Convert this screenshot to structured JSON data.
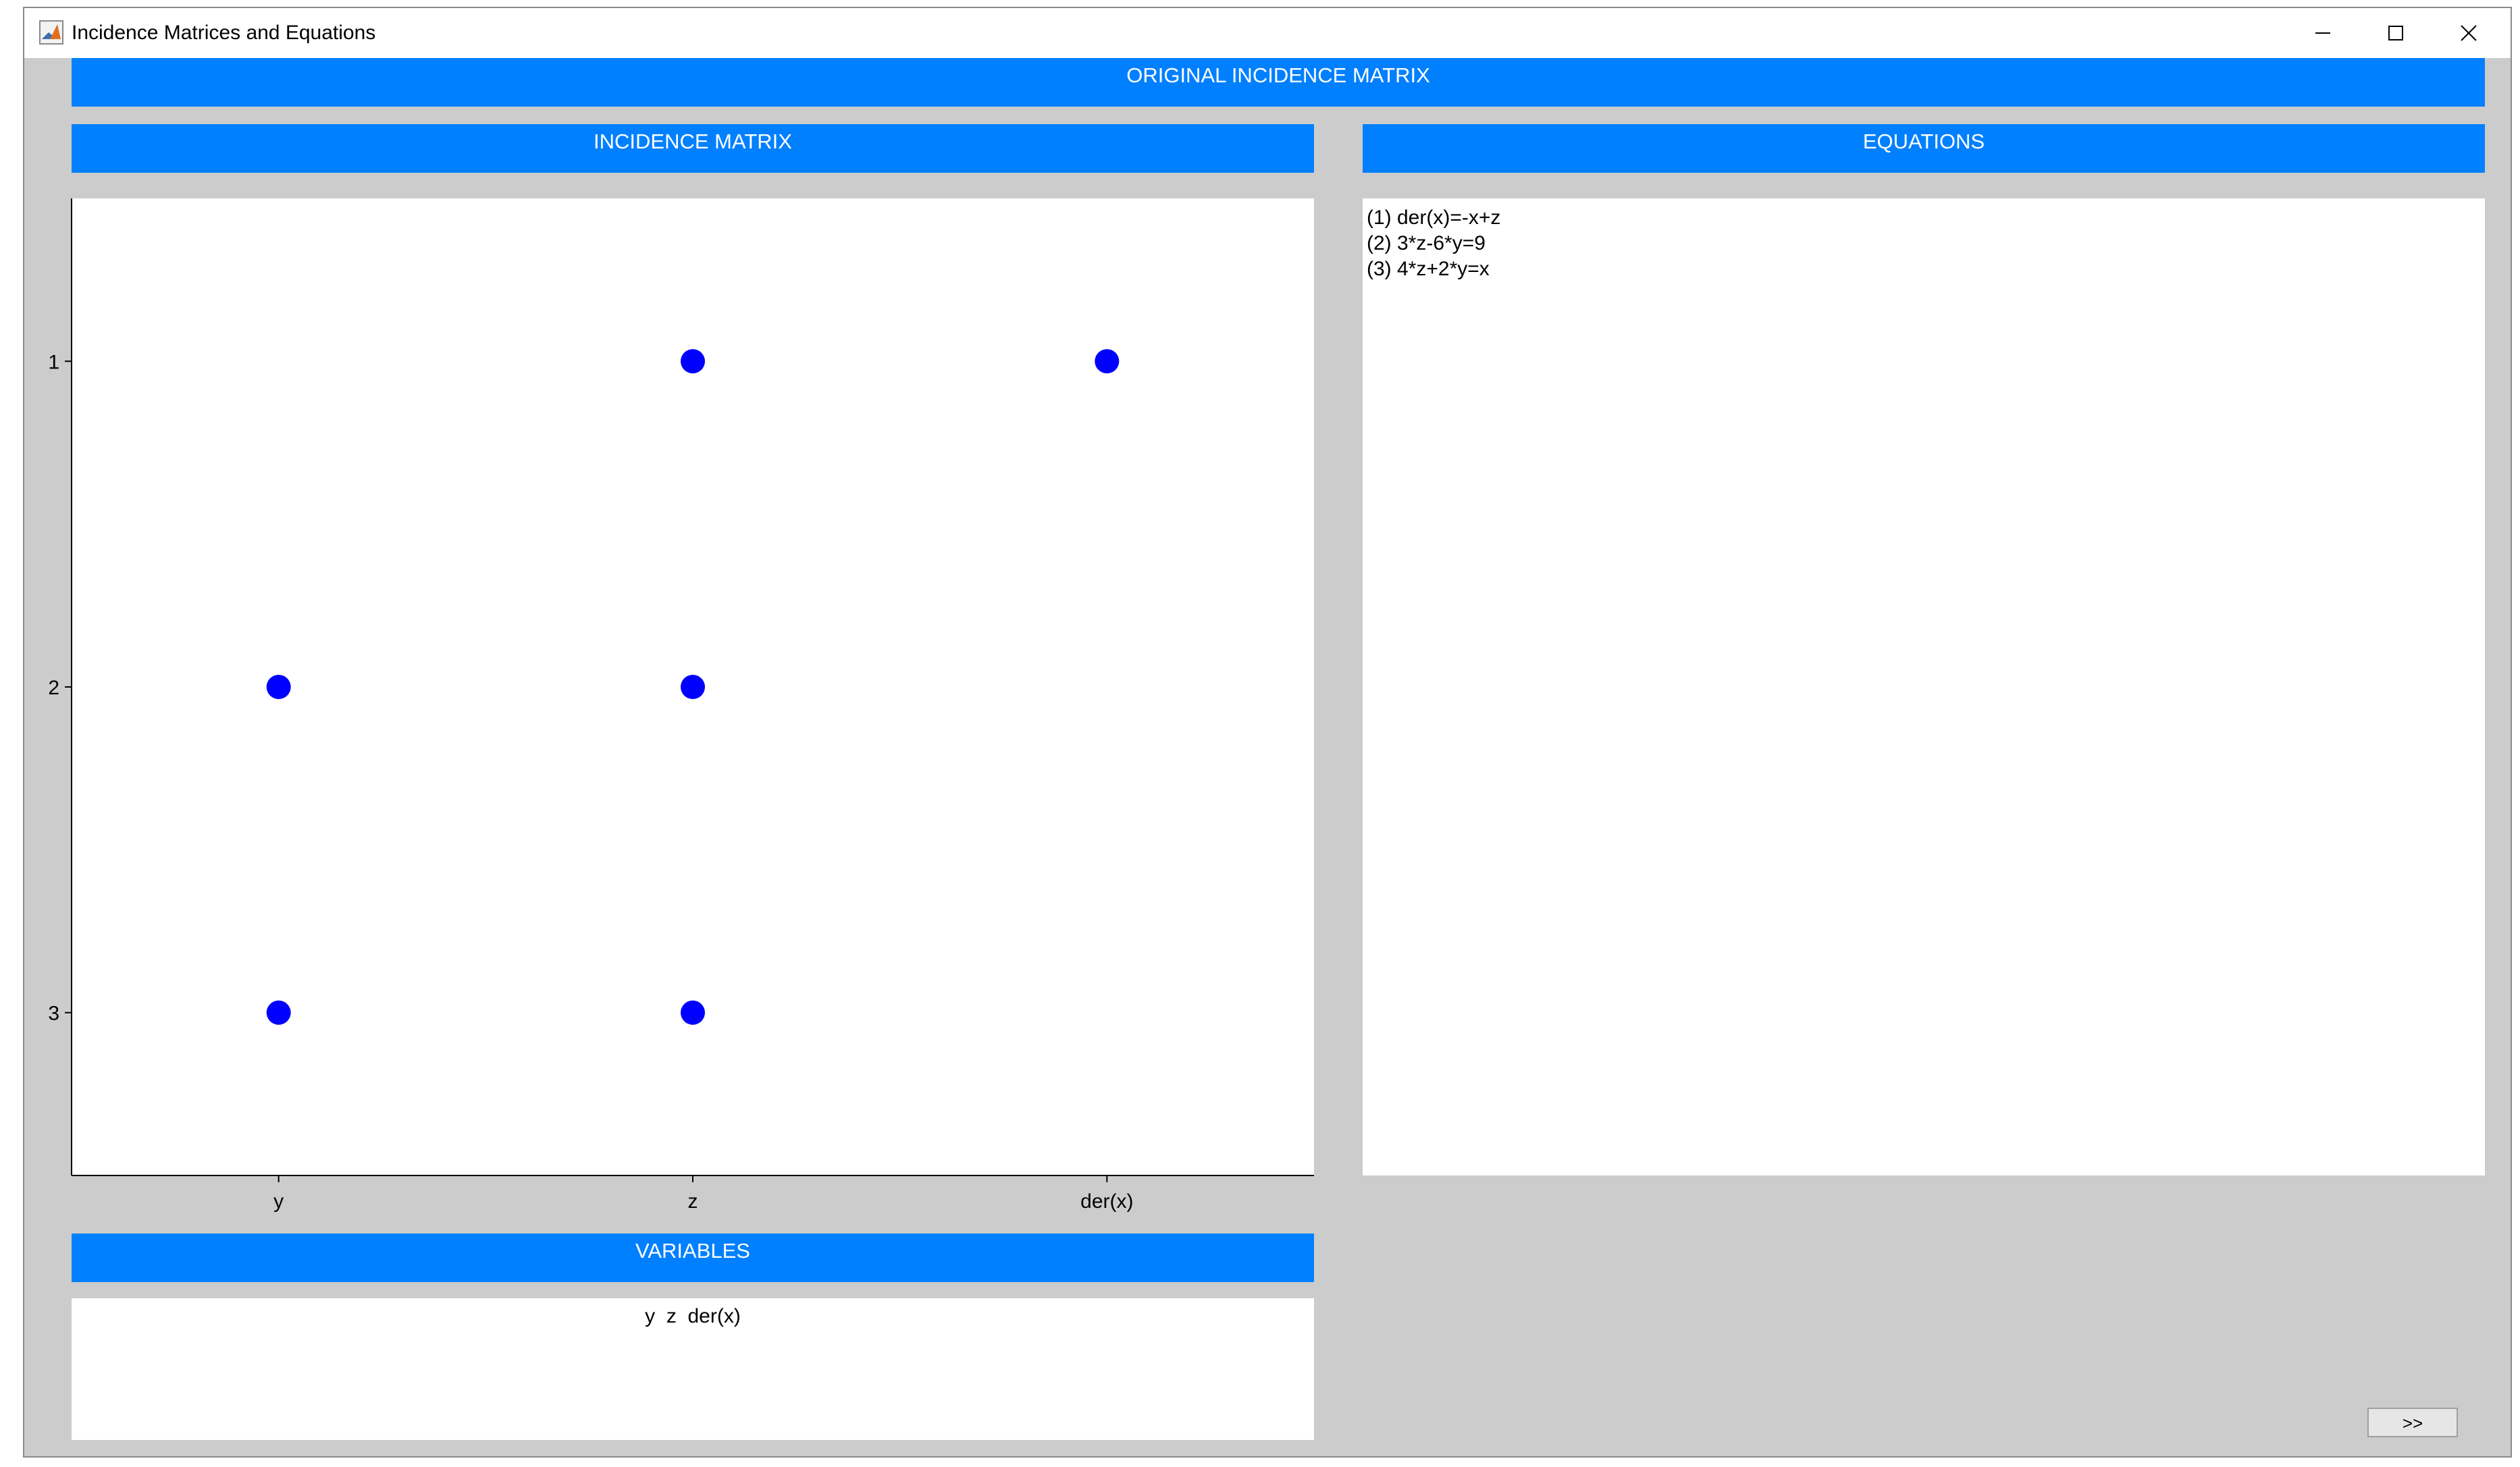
{
  "window": {
    "title": "Incidence Matrices and Equations",
    "icon": "matlab-icon"
  },
  "header": {
    "title": "ORIGINAL INCIDENCE MATRIX"
  },
  "incidence": {
    "title": "INCIDENCE MATRIX",
    "chart_data": {
      "type": "scatter",
      "x_categories": [
        "y",
        "z",
        "der(x)"
      ],
      "y_ticks": [
        "1",
        "2",
        "3"
      ],
      "y_axis_reversed": true,
      "marker_color": "#0000ff",
      "points": [
        {
          "x": "z",
          "y": 1
        },
        {
          "x": "der(x)",
          "y": 1
        },
        {
          "x": "y",
          "y": 2
        },
        {
          "x": "z",
          "y": 2
        },
        {
          "x": "y",
          "y": 3
        },
        {
          "x": "z",
          "y": 3
        }
      ]
    }
  },
  "equations": {
    "title": "EQUATIONS",
    "lines": [
      "(1) der(x)=-x+z",
      "(2) 3*z-6*y=9",
      "(3) 4*z+2*y=x"
    ]
  },
  "variables": {
    "title": "VARIABLES",
    "text": "y  z  der(x)"
  },
  "next_button": {
    "label": ">>"
  },
  "colors": {
    "band": "#0080ff",
    "background": "#cccccc",
    "marker": "#0000ff"
  }
}
